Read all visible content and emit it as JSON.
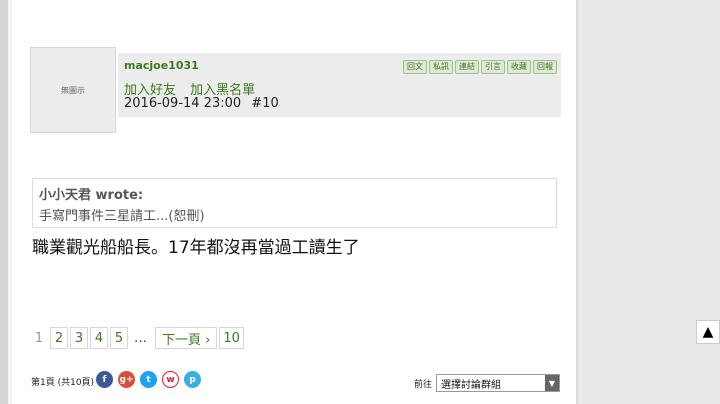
{
  "post": {
    "avatar_text": "無圖示",
    "username": "macjoe1031",
    "add_friend": "加入好友",
    "add_blacklist": "加入黑名單",
    "datetime": "2016-09-14 23:00",
    "post_number": "#10",
    "actions": [
      "回文",
      "私訊",
      "連結",
      "引言",
      "收藏",
      "回報"
    ],
    "quote_author": "小小天君 wrote:",
    "quote_text": "手寫門事件三星請工...(恕刪)",
    "body": "職業觀光船船長。17年都沒再當過工讀生了"
  },
  "pagination": {
    "current": "1",
    "pages": [
      "2",
      "3",
      "4",
      "5"
    ],
    "ellipsis": "…",
    "next": "下一頁 ›",
    "last": "10",
    "info": "第1頁 (共10頁)"
  },
  "social": [
    "f",
    "g+",
    "t",
    "w",
    "p"
  ],
  "forum_select": {
    "label": "前往",
    "value": "選擇討論群組"
  },
  "to_top": "▲"
}
